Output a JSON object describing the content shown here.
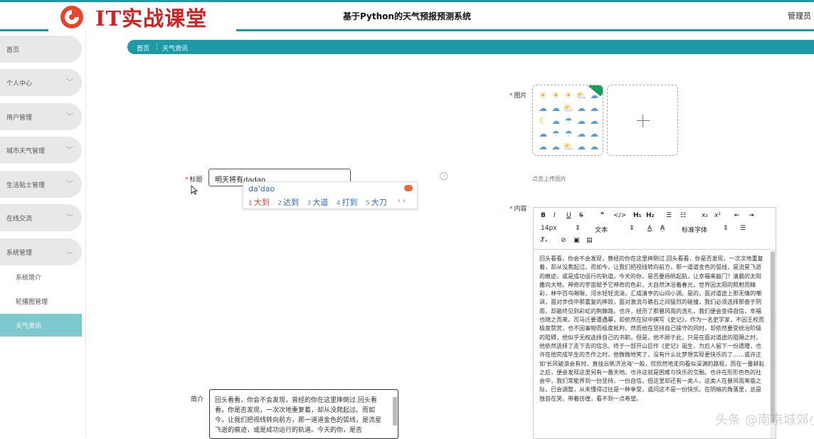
{
  "header": {
    "logo_text": "IT实战课堂",
    "title": "基于Python的天气预报预测系统",
    "user": "管理员",
    "accent": "#1e9aa6",
    "logo_color": "#d32222"
  },
  "sidebar": {
    "items": [
      {
        "label": "首页"
      },
      {
        "label": "个人中心",
        "chevron": "﹀"
      },
      {
        "label": "用户管理",
        "chevron": "﹀"
      },
      {
        "label": "城市天气管理",
        "chevron": "﹀"
      },
      {
        "label": "生活贴士管理",
        "chevron": "﹀"
      },
      {
        "label": "在线交流",
        "chevron": "﹀"
      },
      {
        "label": "系统管理",
        "chevron": "︿"
      }
    ],
    "subitems": [
      {
        "label": "系统简介"
      },
      {
        "label": "轮播图管理"
      },
      {
        "label": "天气资讯",
        "active": true
      }
    ]
  },
  "breadcrumb": {
    "home": "首页",
    "separator": "⋮",
    "current": "天气资讯"
  },
  "form": {
    "title_label": "标题",
    "title_value": "明天将有dadao",
    "image_label": "图片",
    "upload_hint": "点击上传图片",
    "content_label": "内容",
    "summary_label": "简介",
    "summary_text": "回头看看，你会不会发现，曾经的你在这里摔倒过.回头看看，你是否发现，一次次地重复着，却从没爬起过。而如今，让我们把视线转向前方，那一道道金色的弧线，是流星飞逝的痕迹，或是成功运行的轨道。今天的你，是否"
  },
  "ime": {
    "pinyin": "da'dao",
    "candidates": [
      {
        "n": "1",
        "text": "大到"
      },
      {
        "n": "2",
        "text": "达到"
      },
      {
        "n": "3",
        "text": "大道"
      },
      {
        "n": "4",
        "text": "打到"
      },
      {
        "n": "5",
        "text": "大刀"
      }
    ],
    "nav": "‹ ›"
  },
  "editor": {
    "size": "14px",
    "paragraph": "文本",
    "font": "标准字体",
    "content": "回头看看，你会不会发现，曾经的你在这里摔倒过.回头看看，你是否发现，一次次地重复着，却从没爬起过。而如今，让我们把视线转向前方，那一道道金色的弧线，是流星飞逝的痕迹，或是成功运行的轨道。今天的你，是否要扬帆起航，让幸福来敲门？清晨的太阳撒向大地，神奇的宇宙赋予它神奇的色彩，大自然沐浴着春光，世界因太阳的照射而精彩，林中百鸟啾啾，河水轻轻流淌，汇成清亨的山间小调。是的，面对道途上那无情的嘲讽，面对步伐中那重复的摔跤，面对激流与礁石之间猛烈的碰撞，我们必须选择那奋于阴雨，却最终见到彩虹的荆棘路。也许，经历了那暴风雨的洗礼，我们便会变得自信，幸福也随之而来。司马迁要遭遇摹，却依然在狱中撰写《史记》，作为一名史学家，不因王权而极度赞赏，也不因事物而极度批判，然而他在坚持自己操守的同时，却依然要受统治阶级的阻碍，他似乎无权选择自己的书职。但是，他不顾于此，只是在面对道途的阻隔之时，他依然选择了走下去的信念。终于一部开山巨作《史记》诞生，为后人留下一份遗赠，也许在他完成毕生的杰作之时，他微微地笑了，没有什么比梦想实现更快乐的了……或许正如'长风破浪会有时，直挂云帆济沧海'一般，欣欣然地走向看似深渊的路程，而在一番耕耘之后，便会发现这里另有一番天地。也许这就是困难与快乐的交融。也许在形形色色的社会中，我们常能界到一份坚持，一份自信。但这里却还有一类人，这类人在暴风雨来临之际，已会调整，从未懂得过往是一种享受，或问这不是一份快乐。在阴暗的角落里，总是独自在哭，带着彷徨，看不到一点希望。"
  },
  "watermark": "头条 @南京城郊小元撒"
}
